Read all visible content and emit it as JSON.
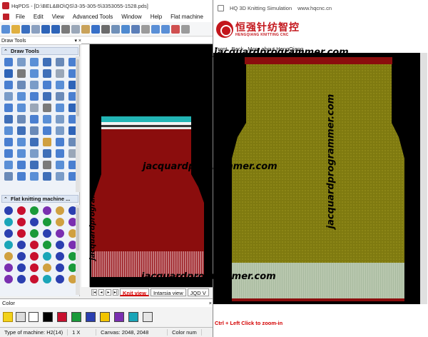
{
  "app": {
    "title": "HqPDS - [D:\\BEL&BO\\QS\\3-35-305-5\\3353055-1528.pds]",
    "menu": [
      "File",
      "Edit",
      "View",
      "Advanced Tools",
      "Window",
      "Help",
      "Flat machine"
    ]
  },
  "draw_tools": {
    "header": "Draw Tools",
    "pin": "▾ ×",
    "section1": "Draw Tools",
    "section2": "Flat knitting machine ..."
  },
  "tabs": [
    "Knit view",
    "Intarsia view",
    "JQD V"
  ],
  "color": {
    "header": "Color",
    "close": "×",
    "swatches": [
      "#ffffff",
      "#000000",
      "#c8102e",
      "#1a9a3a",
      "#2b3fb0",
      "#f2c400",
      "#7a2fb0",
      "#1aa5b8",
      "#e6e6e6"
    ]
  },
  "status": {
    "machine": "Type of machine: H2(14)",
    "zoom": "1 X",
    "canvas": "Canvas: 2048, 2048",
    "color_num": "Color num"
  },
  "sim": {
    "title": "HQ 3D Knitting Simulation",
    "url": "www.hqcnc.cn",
    "logo_cn": "恒强针纺智控",
    "logo_en": "HENGQIANG KNITTING CNC",
    "menu": [
      "Front",
      "Back",
      "More about HengQiang"
    ],
    "hint": "Ctrl + Left Click to zoom-in"
  },
  "watermark": {
    "text": "jacquardprogrammer.com"
  },
  "colors": {
    "garment_red": "#8b0d0d",
    "garment_olive": "#7f7a10",
    "rib_light": "#a9bba0",
    "stripe_cyan": "#22b5b5"
  }
}
